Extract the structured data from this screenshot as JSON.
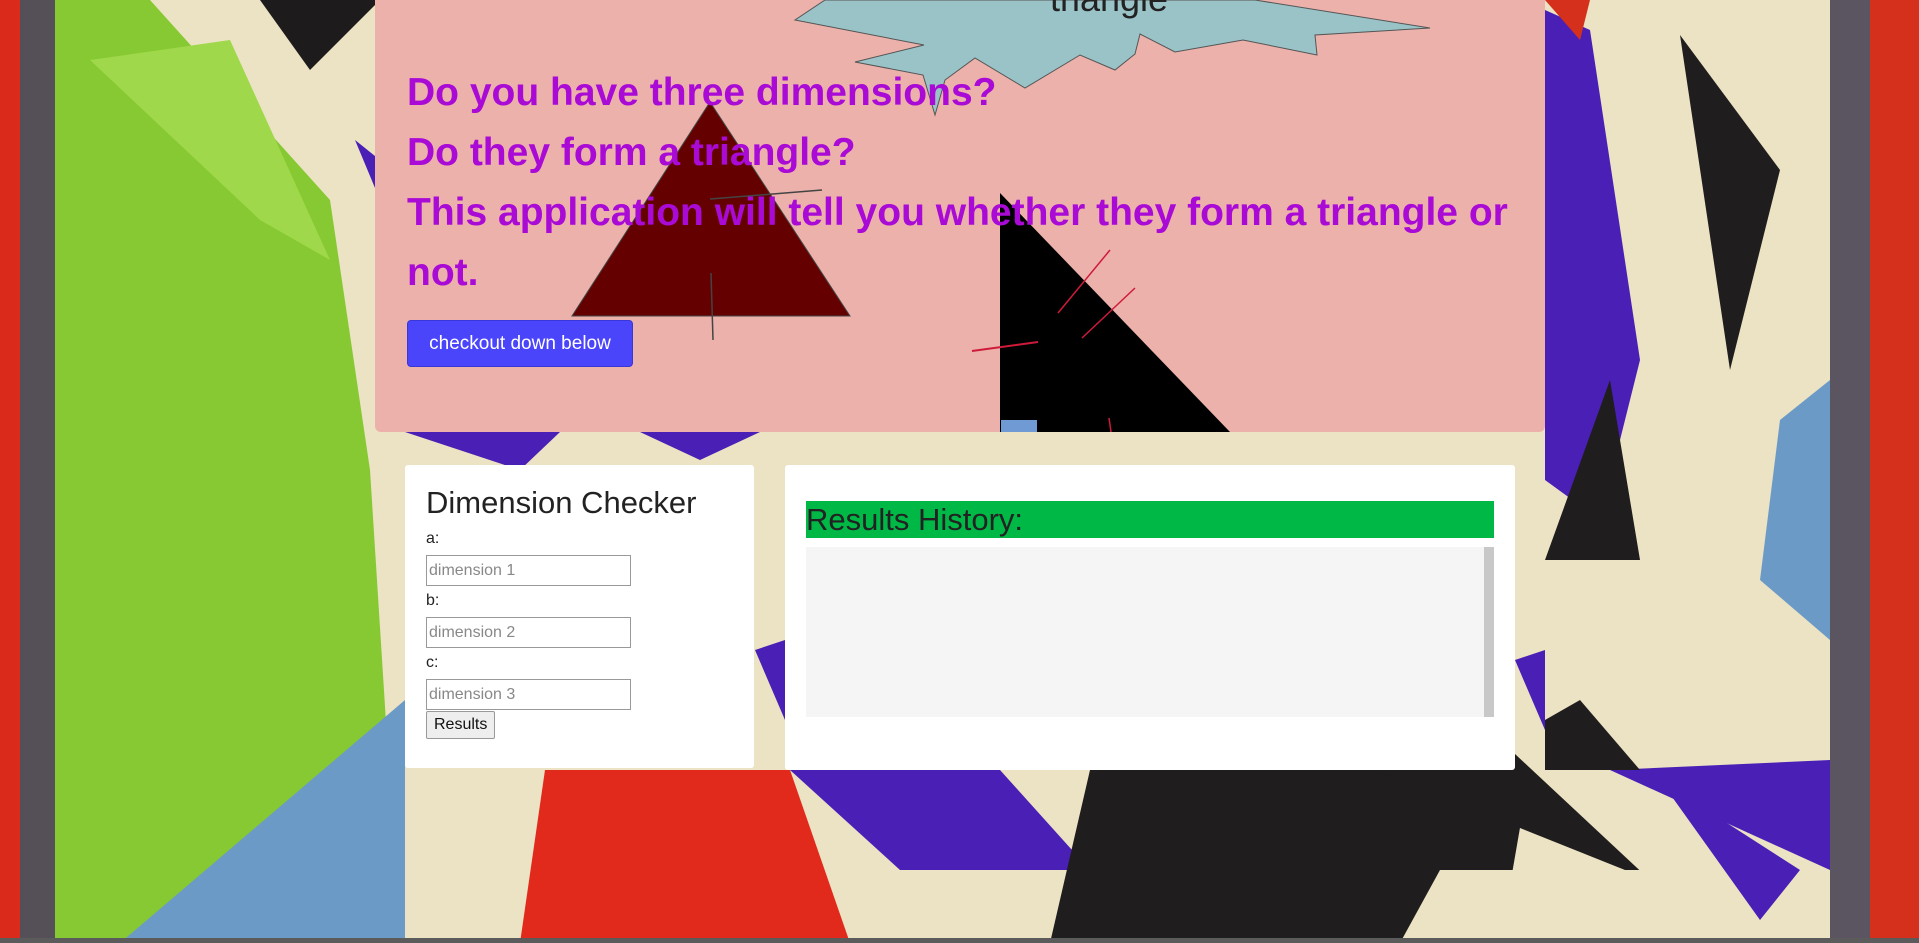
{
  "hero": {
    "burst_label": "triangle",
    "line1": "Do you have three dimensions?",
    "line2": "Do they form a triangle?",
    "line3": "This application will tell you whether they form a triangle or not.",
    "checkout_label": "checkout down below"
  },
  "checker": {
    "title": "Dimension Checker",
    "label_a": "a:",
    "label_b": "b:",
    "label_c": "c:",
    "placeholder_a": "dimension 1",
    "placeholder_b": "dimension 2",
    "placeholder_c": "dimension 3",
    "results_label": "Results"
  },
  "history": {
    "title": "Results History:"
  },
  "colors": {
    "hero_bg": "#ebb1aa",
    "hero_text": "#a90ad6",
    "button": "#4a44fb",
    "history_header": "#00b846"
  }
}
